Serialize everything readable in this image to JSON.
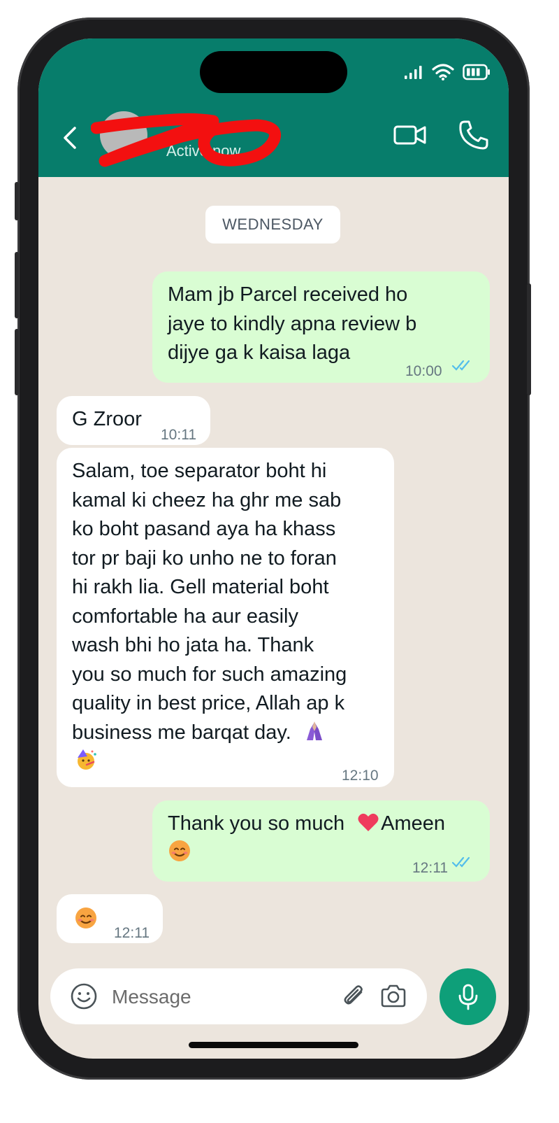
{
  "contact": {
    "status": "Active now"
  },
  "chat": {
    "date_separator": "WEDNESDAY",
    "messages": [
      {
        "dir": "out",
        "lines": [
          "Mam jb Parcel received ho",
          "jaye to kindly apna review b",
          "dijye ga k kaisa laga"
        ],
        "time": "10:00",
        "read": true
      },
      {
        "dir": "in",
        "lines": [
          "G Zroor"
        ],
        "time": "10:11"
      },
      {
        "dir": "in",
        "lines": [
          "Salam, toe separator boht hi",
          "kamal ki cheez ha ghr me sab",
          "ko boht pasand aya ha khass",
          "tor pr baji ko unho ne to foran",
          "hi rakh lia. Gell material boht",
          "comfortable ha aur easily",
          "wash bhi ho jata ha. Thank",
          "you so much for such amazing",
          "quality in best price, Allah ap k",
          "business me barqat day."
        ],
        "emojis": [
          "folded-hands",
          "partying-face"
        ],
        "time": "12:10"
      },
      {
        "dir": "out",
        "line_before_emoji": "Thank you so much",
        "line_after_emoji": "Ameen",
        "emojis": [
          "red-heart",
          "smiling-face"
        ],
        "time": "12:11",
        "read": true
      },
      {
        "dir": "in",
        "emojis": [
          "smiling-face"
        ],
        "time": "12:11"
      }
    ]
  },
  "composer": {
    "placeholder": "Message"
  },
  "colors": {
    "header": "#077d6b",
    "chat_bg": "#ece5dd",
    "outgoing": "#d9fdd3",
    "incoming": "#ffffff",
    "read_ticks": "#53bdeb",
    "mic": "#0e9f79"
  }
}
